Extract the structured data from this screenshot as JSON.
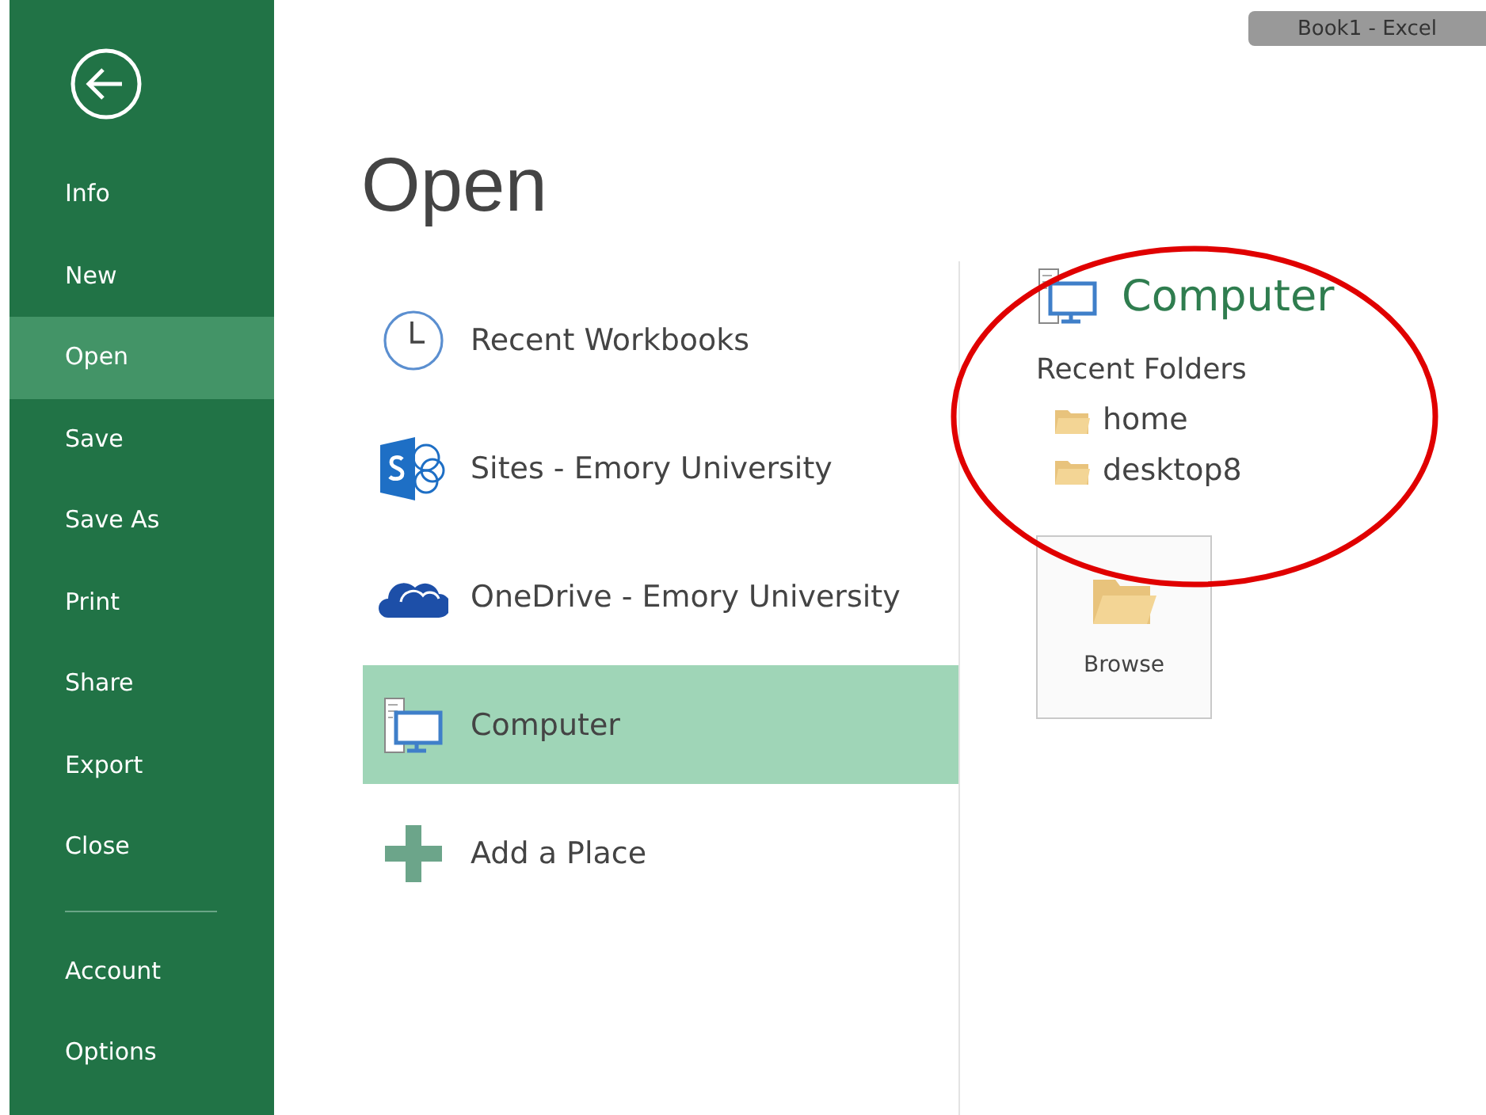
{
  "window": {
    "title": "Book1 - Excel"
  },
  "sidebar": {
    "items": [
      {
        "label": "Info",
        "selected": false
      },
      {
        "label": "New",
        "selected": false
      },
      {
        "label": "Open",
        "selected": true
      },
      {
        "label": "Save",
        "selected": false
      },
      {
        "label": "Save As",
        "selected": false
      },
      {
        "label": "Print",
        "selected": false
      },
      {
        "label": "Share",
        "selected": false
      },
      {
        "label": "Export",
        "selected": false
      },
      {
        "label": "Close",
        "selected": false
      }
    ],
    "bottom_items": [
      {
        "label": "Account",
        "selected": false
      },
      {
        "label": "Options",
        "selected": false
      }
    ]
  },
  "heading": "Open",
  "places": [
    {
      "kind": "recent",
      "label": "Recent Workbooks",
      "selected": false
    },
    {
      "kind": "sharepoint",
      "label": "Sites - Emory University",
      "selected": false
    },
    {
      "kind": "onedrive",
      "label": "OneDrive - Emory University",
      "selected": false
    },
    {
      "kind": "computer",
      "label": "Computer",
      "selected": true
    },
    {
      "kind": "add",
      "label": "Add a Place",
      "selected": false
    }
  ],
  "detail": {
    "title": "Computer",
    "section": "Recent Folders",
    "folders": [
      {
        "name": "home"
      },
      {
        "name": "desktop8"
      }
    ],
    "browse_button": "Browse"
  }
}
